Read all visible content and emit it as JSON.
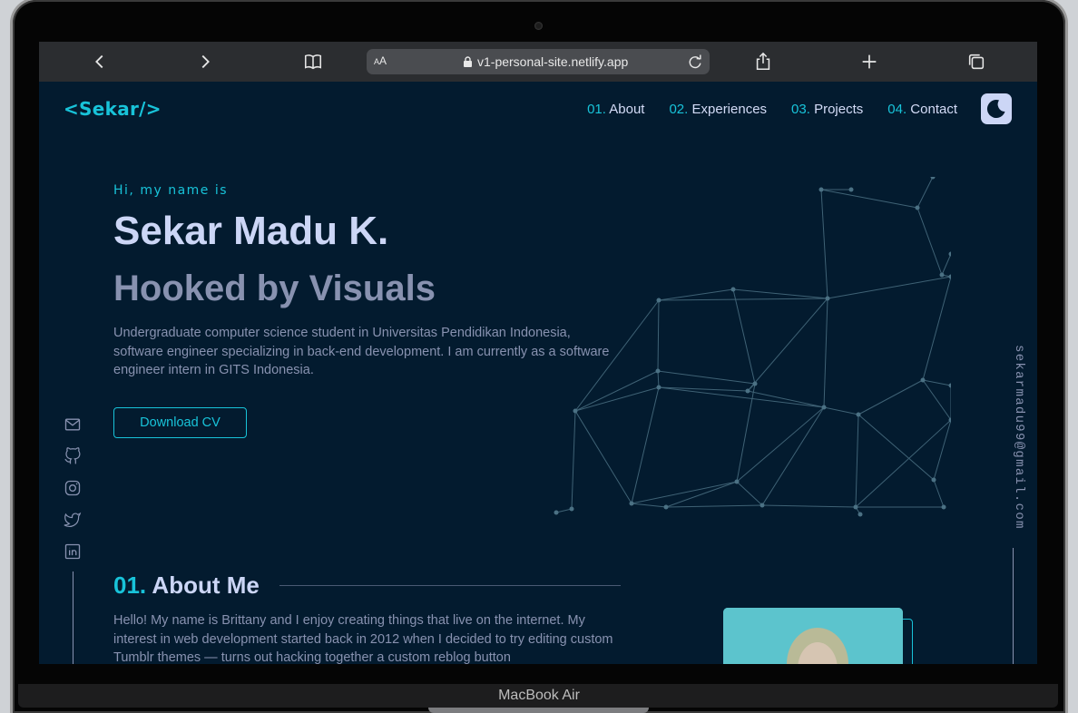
{
  "browser": {
    "text_size_label": "AA",
    "url": "v1-personal-site.netlify.app"
  },
  "site": {
    "logo": "<Sekar/>",
    "nav": [
      {
        "num": "01.",
        "label": "About"
      },
      {
        "num": "02.",
        "label": "Experiences"
      },
      {
        "num": "03.",
        "label": "Projects"
      },
      {
        "num": "04.",
        "label": "Contact"
      }
    ],
    "theme_icon": "moon-icon"
  },
  "hero": {
    "greeting": "Hi, my name is",
    "name": "Sekar Madu K.",
    "tagline": "Hooked by Visuals",
    "bio": "Undergraduate computer science student in Universitas Pendidikan Indonesia, software engineer specializing in back-end development. I am currently as a software engineer intern in GITS Indonesia.",
    "cta": "Download CV"
  },
  "social_icons": [
    "mail-icon",
    "github-icon",
    "instagram-icon",
    "twitter-icon",
    "linkedin-icon"
  ],
  "email": "sekarmadu99@gmail.com",
  "about": {
    "num": "01.",
    "title": "About Me",
    "text": "Hello! My name is Brittany and I enjoy creating things that live on the internet. My interest in web development started back in 2012 when I decided to try editing custom Tumblr themes — turns out hacking together a custom reblog button"
  },
  "device_label": "MacBook Air",
  "colors": {
    "accent": "#18c3d9",
    "background": "#031b2f",
    "heading": "#ccd6f6",
    "muted": "#8892b0"
  }
}
